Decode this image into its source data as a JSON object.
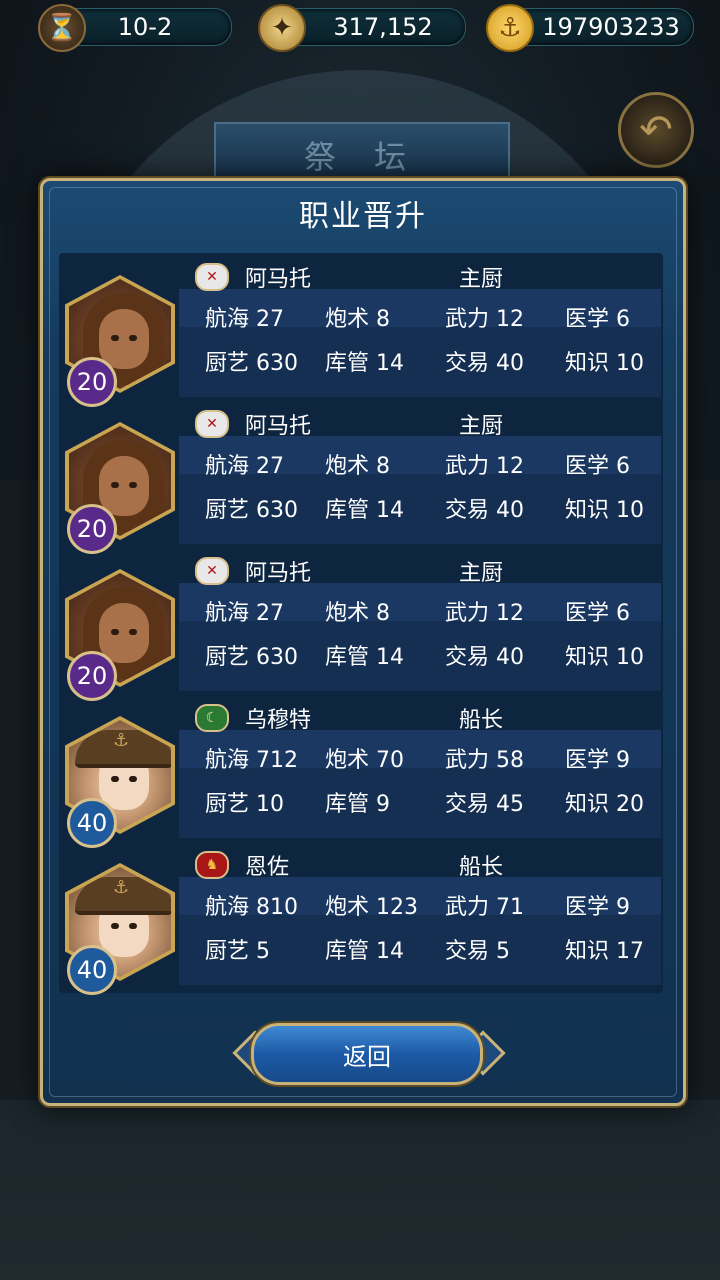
{
  "topbar": {
    "level": "10-2",
    "gold": "317,152",
    "ducats": "197903233",
    "icons": {
      "level": "hourglass-icon",
      "gold": "compass-coin-icon",
      "ducats": "anchor-coin-icon"
    }
  },
  "screen": {
    "header": "祭 坛",
    "back_icon": "back-arrow-icon"
  },
  "dialog": {
    "title": "职业晋升",
    "return_label": "返回",
    "stat_labels": [
      "航海",
      "炮术",
      "武力",
      "医学",
      "厨艺",
      "库管",
      "交易",
      "知识"
    ],
    "sailors": [
      {
        "name": "阿马托",
        "job": "主厨",
        "level": "20",
        "flag": "burgundy-cross-flag",
        "portrait": "chef-woman",
        "stats": [
          "航海 27",
          "炮术 8",
          "武力 12",
          "医学 6",
          "厨艺 630",
          "库管 14",
          "交易 40",
          "知识 10"
        ]
      },
      {
        "name": "阿马托",
        "job": "主厨",
        "level": "20",
        "flag": "burgundy-cross-flag",
        "portrait": "chef-woman",
        "stats": [
          "航海 27",
          "炮术 8",
          "武力 12",
          "医学 6",
          "厨艺 630",
          "库管 14",
          "交易 40",
          "知识 10"
        ]
      },
      {
        "name": "阿马托",
        "job": "主厨",
        "level": "20",
        "flag": "burgundy-cross-flag",
        "portrait": "chef-woman",
        "stats": [
          "航海 27",
          "炮术 8",
          "武力 12",
          "医学 6",
          "厨艺 630",
          "库管 14",
          "交易 40",
          "知识 10"
        ]
      },
      {
        "name": "乌穆特",
        "job": "船长",
        "level": "40",
        "flag": "ottoman-flag",
        "portrait": "captain-man",
        "stats": [
          "航海 712",
          "炮术 70",
          "武力 58",
          "医学 9",
          "厨艺 10",
          "库管 9",
          "交易 45",
          "知识 20"
        ]
      },
      {
        "name": "恩佐",
        "job": "船长",
        "level": "40",
        "flag": "venice-lion-flag",
        "portrait": "captain-man",
        "stats": [
          "航海 810",
          "炮术 123",
          "武力 71",
          "医学 9",
          "厨艺 5",
          "库管 14",
          "交易 5",
          "知识 17"
        ]
      }
    ]
  },
  "colors": {
    "panel": "#143a5c",
    "gold_border": "#c9b27a",
    "level_purple": "#5a2a8a",
    "level_blue": "#1f5a9c"
  }
}
